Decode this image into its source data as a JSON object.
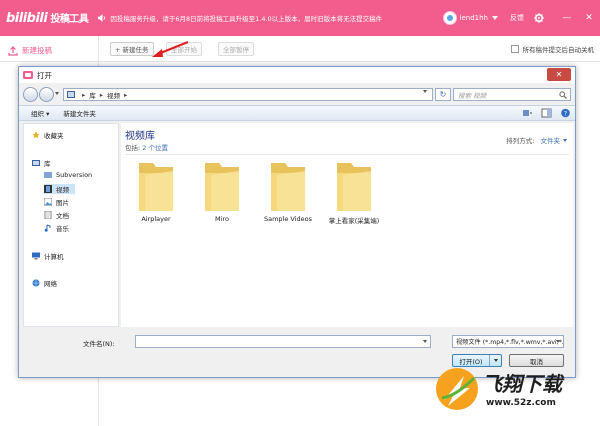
{
  "app": {
    "logo": "bilibili",
    "title": "投稿工具",
    "notice": "因投稿服务升级，请于6月8日前将投稿工具升级至1.4.0以上版本，届时旧版本将无法提交稿件",
    "username": "lend1hh",
    "feedback": "反馈",
    "brand_color": "#f25d8e"
  },
  "sidebar": {
    "new_upload": "新建投稿"
  },
  "toolbar": {
    "new_task": "+ 新建任务",
    "start_all": "全部开始",
    "pause_all": "全部暂停",
    "auto_close": "所有稿件提交后自动关机"
  },
  "dialog": {
    "title": "打开",
    "close": "✕",
    "address": [
      "库",
      "视频"
    ],
    "search_placeholder": "搜索 视频",
    "organize": "组织 ▾",
    "new_folder": "新建文件夹",
    "nav": {
      "favorites": "收藏夹",
      "library": "库",
      "lib_items": [
        "Subversion",
        "视频",
        "图片",
        "文档",
        "音乐"
      ],
      "computer": "计算机",
      "network": "网络"
    },
    "library_title": "视频库",
    "includes_prefix": "包括:",
    "includes_link": "2 个位置",
    "arrange_label": "排列方式:",
    "arrange_value": "文件夹",
    "folders": [
      "Airplayer",
      "Miro",
      "Sample Videos",
      "掌上看家(采集端)"
    ],
    "filename_label": "文件名(N):",
    "filetype": "视频文件 (*.mp4,*.flv,*.wmv,*.avi,*.mov)",
    "open_btn": "打开(O)",
    "cancel_btn": "取消"
  },
  "watermark": {
    "name": "飞翔下载",
    "url": "www.52z.com"
  }
}
